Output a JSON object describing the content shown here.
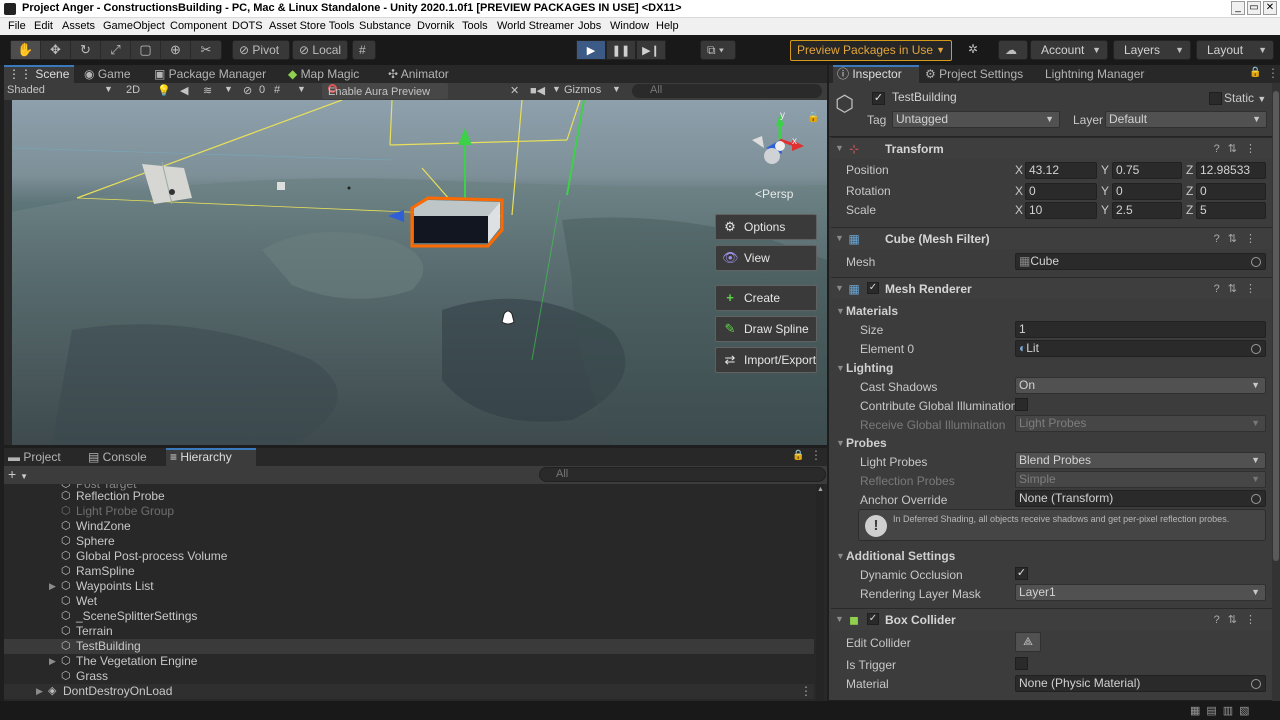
{
  "window": {
    "title": "Project Anger - ConstructionsBuilding - PC, Mac & Linux Standalone - Unity 2020.1.0f1 [PREVIEW PACKAGES IN USE] <DX11>",
    "controls": [
      "_",
      "▭",
      "✕"
    ]
  },
  "menu": [
    "File",
    "Edit",
    "Assets",
    "GameObject",
    "Component",
    "DOTS",
    "Asset Store Tools",
    "Substance",
    "Dvornik",
    "Tools",
    "World Streamer",
    "Jobs",
    "Window",
    "Help"
  ],
  "toolbar": {
    "pivot": "Pivot",
    "local": "Local",
    "preview_packages": "Preview Packages in Use",
    "account": "Account",
    "layers": "Layers",
    "layout": "Layout"
  },
  "scene_tabs": [
    "Scene",
    "Game",
    "Package Manager",
    "Map Magic",
    "Animator"
  ],
  "scene_toolbar": {
    "shading": "Shaded",
    "mode_2d": "2D",
    "hidden_count": "0",
    "aura_button": "Enable Aura Preview",
    "gizmos": "Gizmos",
    "search_placeholder": "All"
  },
  "scene_view": {
    "persp_label": "Persp",
    "buttons": [
      "Options",
      "View",
      "Create",
      "Draw Spline",
      "Import/Export"
    ],
    "gizmo_axes": [
      "y",
      "x"
    ]
  },
  "bottom_tabs": [
    "Project",
    "Console",
    "Hierarchy"
  ],
  "hierarchy": {
    "search_placeholder": "All",
    "items": [
      {
        "label": "Reflection Probe",
        "dim": false,
        "expandable": false
      },
      {
        "label": "Light Probe Group",
        "dim": true,
        "expandable": false
      },
      {
        "label": "WindZone",
        "dim": false,
        "expandable": false
      },
      {
        "label": "Sphere",
        "dim": false,
        "expandable": false
      },
      {
        "label": "Global Post-process Volume",
        "dim": false,
        "expandable": false
      },
      {
        "label": "RamSpline",
        "dim": false,
        "expandable": false
      },
      {
        "label": "Waypoints List",
        "dim": false,
        "expandable": true
      },
      {
        "label": "Wet",
        "dim": false,
        "expandable": false
      },
      {
        "label": "_SceneSplitterSettings",
        "dim": false,
        "expandable": false
      },
      {
        "label": "Terrain",
        "dim": false,
        "expandable": false
      },
      {
        "label": "TestBuilding",
        "dim": false,
        "expandable": false,
        "selected": true
      },
      {
        "label": "The Vegetation Engine",
        "dim": false,
        "expandable": true
      },
      {
        "label": "Grass",
        "dim": false,
        "expandable": false
      }
    ],
    "root_item": "DontDestroyOnLoad"
  },
  "inspector": {
    "tabs": [
      "Inspector",
      "Project Settings",
      "Lightning Manager"
    ],
    "object_name": "TestBuilding",
    "static_label": "Static",
    "tag_label": "Tag",
    "tag_value": "Untagged",
    "layer_label": "Layer",
    "layer_value": "Default",
    "transform": {
      "title": "Transform",
      "position_label": "Position",
      "rotation_label": "Rotation",
      "scale_label": "Scale",
      "position": {
        "x": "43.12",
        "y": "0.75",
        "z": "12.98533"
      },
      "rotation": {
        "x": "0",
        "y": "0",
        "z": "0"
      },
      "scale": {
        "x": "10",
        "y": "2.5",
        "z": "5"
      }
    },
    "mesh_filter": {
      "title": "Cube (Mesh Filter)",
      "mesh_label": "Mesh",
      "mesh_value": "Cube"
    },
    "mesh_renderer": {
      "title": "Mesh Renderer",
      "materials_label": "Materials",
      "size_label": "Size",
      "size_value": "1",
      "element_label": "Element 0",
      "element_value": "Lit",
      "lighting_label": "Lighting",
      "cast_shadows_label": "Cast Shadows",
      "cast_shadows_value": "On",
      "contribute_gi_label": "Contribute Global Illumination",
      "receive_gi_label": "Receive Global Illumination",
      "receive_gi_value": "Light Probes",
      "probes_label": "Probes",
      "light_probes_label": "Light Probes",
      "light_probes_value": "Blend Probes",
      "reflection_probes_label": "Reflection Probes",
      "reflection_probes_value": "Simple",
      "anchor_label": "Anchor Override",
      "anchor_value": "None (Transform)",
      "help_text": "In Deferred Shading, all objects receive shadows and get per-pixel reflection probes.",
      "additional_label": "Additional Settings",
      "dynamic_occlusion_label": "Dynamic Occlusion",
      "rendering_layer_label": "Rendering Layer Mask",
      "rendering_layer_value": "Layer1"
    },
    "box_collider": {
      "title": "Box Collider",
      "edit_collider_label": "Edit Collider",
      "is_trigger_label": "Is Trigger",
      "material_label": "Material",
      "material_value": "None (Physic Material)"
    }
  },
  "colors": {
    "accent_blue": "#3a79bb",
    "selection_orange": "#ff6a00",
    "preview_warning": "#e3a53a"
  }
}
